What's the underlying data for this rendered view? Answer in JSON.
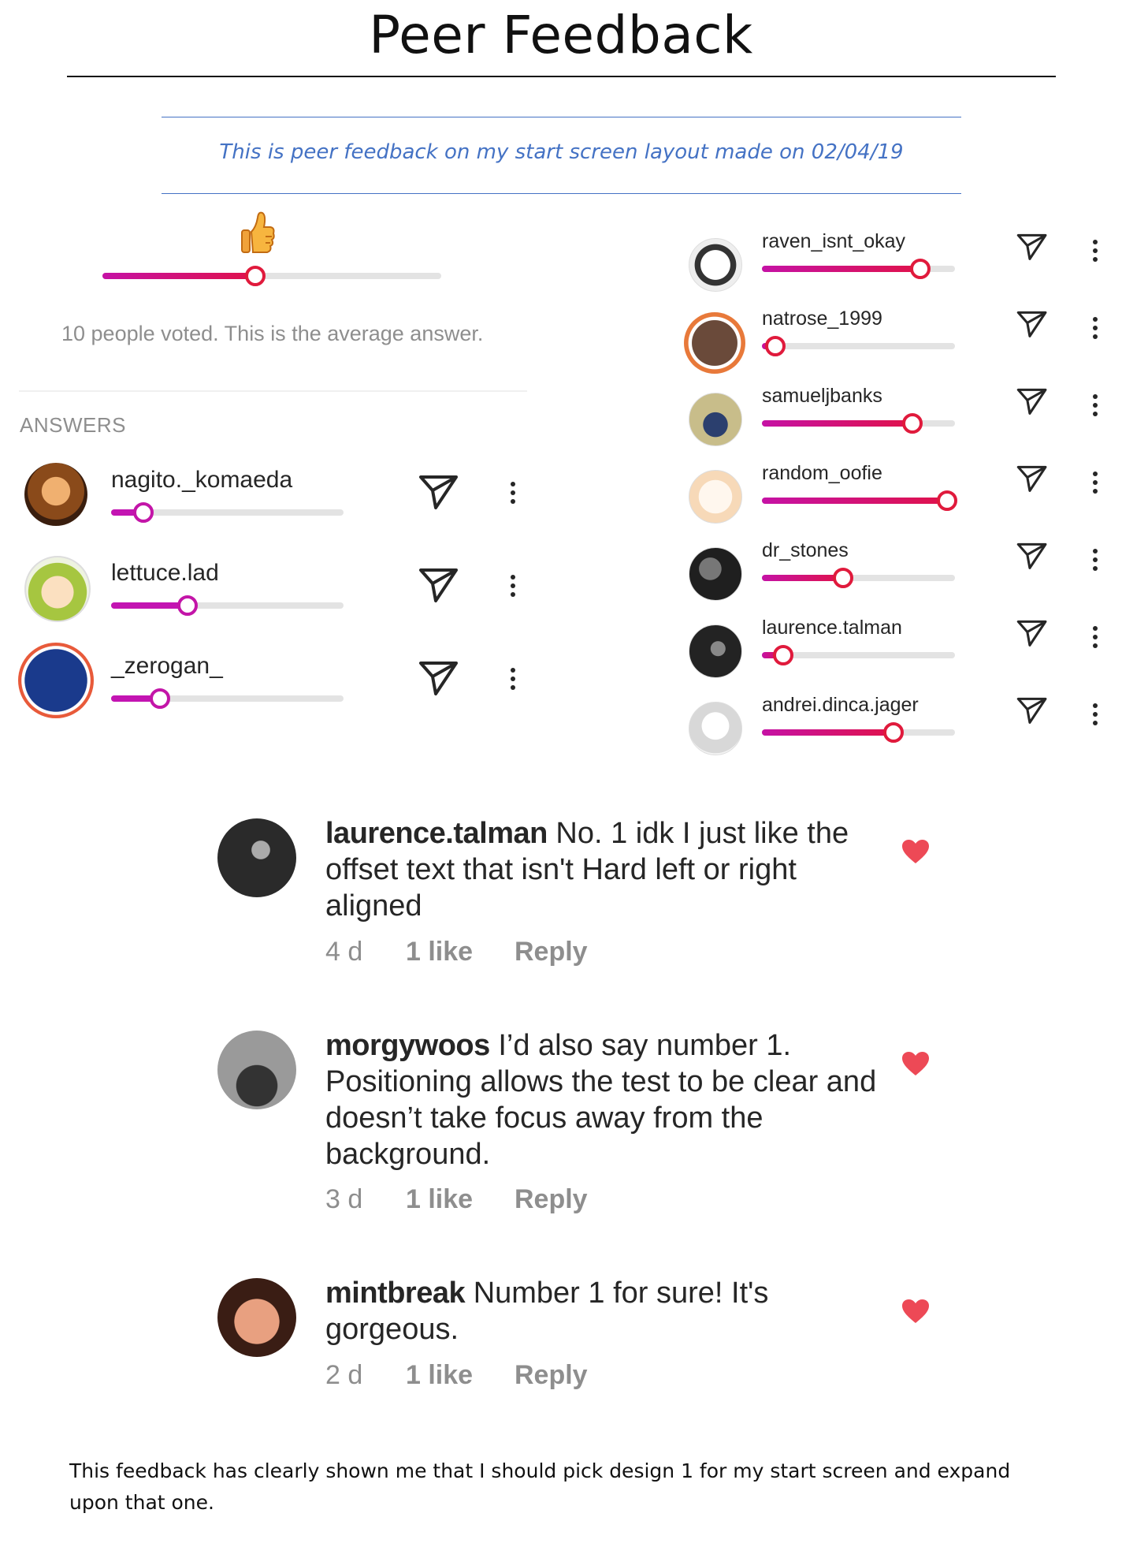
{
  "title": "Peer Feedback",
  "subtitle": "This is peer feedback on my start screen layout made on 02/04/19",
  "poll": {
    "emoji_icon": "thumbs-up-icon",
    "average_value": 0.45,
    "summary": "10 people voted. This is the average answer.",
    "answers_header": "ANSWERS"
  },
  "answers_left": [
    {
      "name": "nagito._komaeda",
      "value": 0.14
    },
    {
      "name": "lettuce.lad",
      "value": 0.33
    },
    {
      "name": "_zerogan_",
      "value": 0.21
    }
  ],
  "answers_right": [
    {
      "name": "raven_isnt_okay",
      "value": 0.82
    },
    {
      "name": "natrose_1999",
      "value": 0.07
    },
    {
      "name": "samueljbanks",
      "value": 0.78
    },
    {
      "name": "random_oofie",
      "value": 0.96
    },
    {
      "name": "dr_stones",
      "value": 0.42
    },
    {
      "name": "laurence.talman",
      "value": 0.11
    },
    {
      "name": "andrei.dinca.jager",
      "value": 0.68
    }
  ],
  "comments": [
    {
      "user": "laurence.talman",
      "text": "No. 1 idk I just like the offset text that isn't Hard left or right aligned",
      "age": "4 d",
      "likes": "1 like",
      "reply": "Reply"
    },
    {
      "user": "morgywoos",
      "text": "I’d also say number 1. Positioning allows the test to be clear and doesn’t take focus away from the background.",
      "age": "3 d",
      "likes": "1 like",
      "reply": "Reply"
    },
    {
      "user": "mintbreak",
      "text": "Number 1 for sure! It's gorgeous.",
      "age": "2 d",
      "likes": "1 like",
      "reply": "Reply"
    }
  ],
  "footer": "This feedback has clearly shown me that I should pick design 1 for my start screen and expand upon that one.",
  "colors": {
    "accent_blue": "#4472c4",
    "slider_pink": "#c512a5",
    "slider_red": "#e0124a",
    "heart": "#ed4956"
  }
}
